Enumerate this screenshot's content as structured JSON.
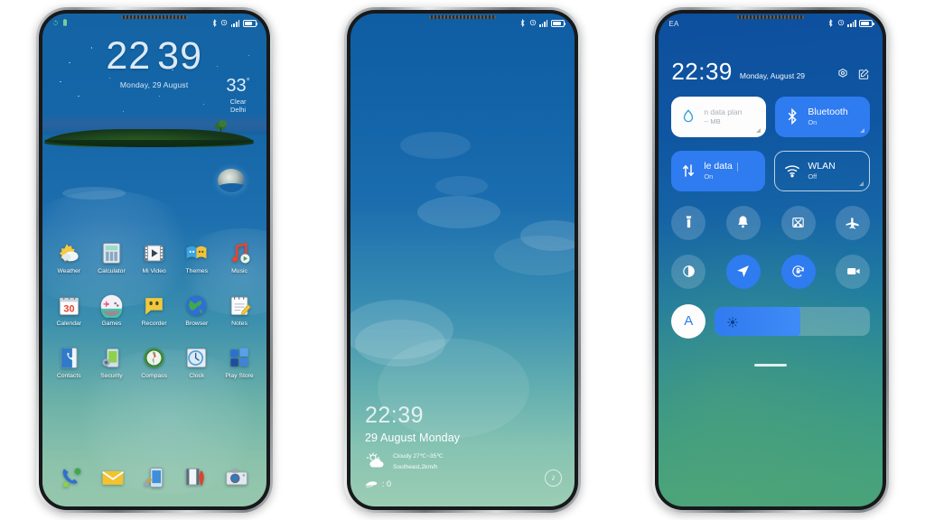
{
  "scene": {
    "background": "#ffffff",
    "phone_count": 3
  },
  "phone1": {
    "name": "home-screen",
    "statusbar": {
      "left_icons": [
        "sync-icon",
        "battery-saver-icon"
      ],
      "right_icons": [
        "bluetooth-icon",
        "alarm-icon",
        "signal-icon",
        "battery-icon"
      ]
    },
    "clock": {
      "hours": "22",
      "minutes": "39",
      "date": "Monday, 29 August"
    },
    "weather": {
      "temperature": "33",
      "degree": "°",
      "condition": "Clear",
      "city": "Delhi"
    },
    "apps": [
      [
        {
          "label": "Weather",
          "icon": "weather-icon"
        },
        {
          "label": "Calculator",
          "icon": "calculator-icon"
        },
        {
          "label": "Mi Video",
          "icon": "video-icon"
        },
        {
          "label": "Themes",
          "icon": "themes-icon"
        },
        {
          "label": "Music",
          "icon": "music-icon"
        }
      ],
      [
        {
          "label": "Calendar",
          "icon": "calendar-icon"
        },
        {
          "label": "Games",
          "icon": "games-icon"
        },
        {
          "label": "Recorder",
          "icon": "recorder-icon"
        },
        {
          "label": "Browser",
          "icon": "browser-icon"
        },
        {
          "label": "Notes",
          "icon": "notes-icon"
        }
      ],
      [
        {
          "label": "Contacts",
          "icon": "contacts-icon"
        },
        {
          "label": "Security",
          "icon": "security-icon"
        },
        {
          "label": "Compass",
          "icon": "compass-icon"
        },
        {
          "label": "Clock",
          "icon": "clock-icon"
        },
        {
          "label": "Play Store",
          "icon": "play-store-icon"
        }
      ]
    ],
    "calendar_day": "30",
    "dock": [
      {
        "icon": "dialer-icon"
      },
      {
        "icon": "mail-icon"
      },
      {
        "icon": "phone-manager-icon"
      },
      {
        "icon": "media-icon"
      },
      {
        "icon": "camera-icon"
      }
    ]
  },
  "phone2": {
    "name": "lock-screen",
    "statusbar": {
      "right_icons": [
        "bluetooth-icon",
        "alarm-icon",
        "signal-icon",
        "battery-icon"
      ]
    },
    "time": "22:39",
    "date": "29 August Monday",
    "weather_line1": "Cloudy 27℃~35℃",
    "weather_line2": "Southeast,2km/h",
    "steps_label": ": 0",
    "music_glyph": "♪"
  },
  "phone3": {
    "name": "control-center",
    "carrier": "EA",
    "statusbar": {
      "right_icons": [
        "bluetooth-icon",
        "alarm-icon",
        "signal-icon",
        "battery-icon"
      ]
    },
    "time": "22:39",
    "date": "Monday, August 29",
    "actions": [
      {
        "name": "settings-gear-icon"
      },
      {
        "name": "edit-icon"
      }
    ],
    "tiles": [
      {
        "title": "n data plan",
        "sub": "-- MB",
        "icon": "data-drop-icon",
        "state": "white"
      },
      {
        "title": "Bluetooth",
        "sub": "On",
        "icon": "bluetooth-icon",
        "state": "blue"
      },
      {
        "title": "le data",
        "sub": "On",
        "icon": "mobile-data-icon",
        "state": "blue"
      },
      {
        "title": "WLAN",
        "sub": "Off",
        "icon": "wifi-icon",
        "state": "outline"
      }
    ],
    "toggles_row1": [
      {
        "name": "flashlight-icon",
        "active": false
      },
      {
        "name": "ringer-bell-icon",
        "active": false
      },
      {
        "name": "screenshot-icon",
        "active": false
      },
      {
        "name": "airplane-mode-icon",
        "active": false
      }
    ],
    "toggles_row2": [
      {
        "name": "dark-mode-icon",
        "active": false
      },
      {
        "name": "location-icon",
        "active": true
      },
      {
        "name": "rotation-lock-icon",
        "active": true
      },
      {
        "name": "screen-recorder-icon",
        "active": false
      }
    ],
    "brightness": {
      "auto_label": "A",
      "level_percent": 55,
      "icon": "brightness-icon"
    }
  },
  "colors": {
    "accent_blue": "#2f7bf0",
    "screen_blue": "#1464a5",
    "screen_teal": "#4aa378",
    "white": "#ffffff"
  }
}
